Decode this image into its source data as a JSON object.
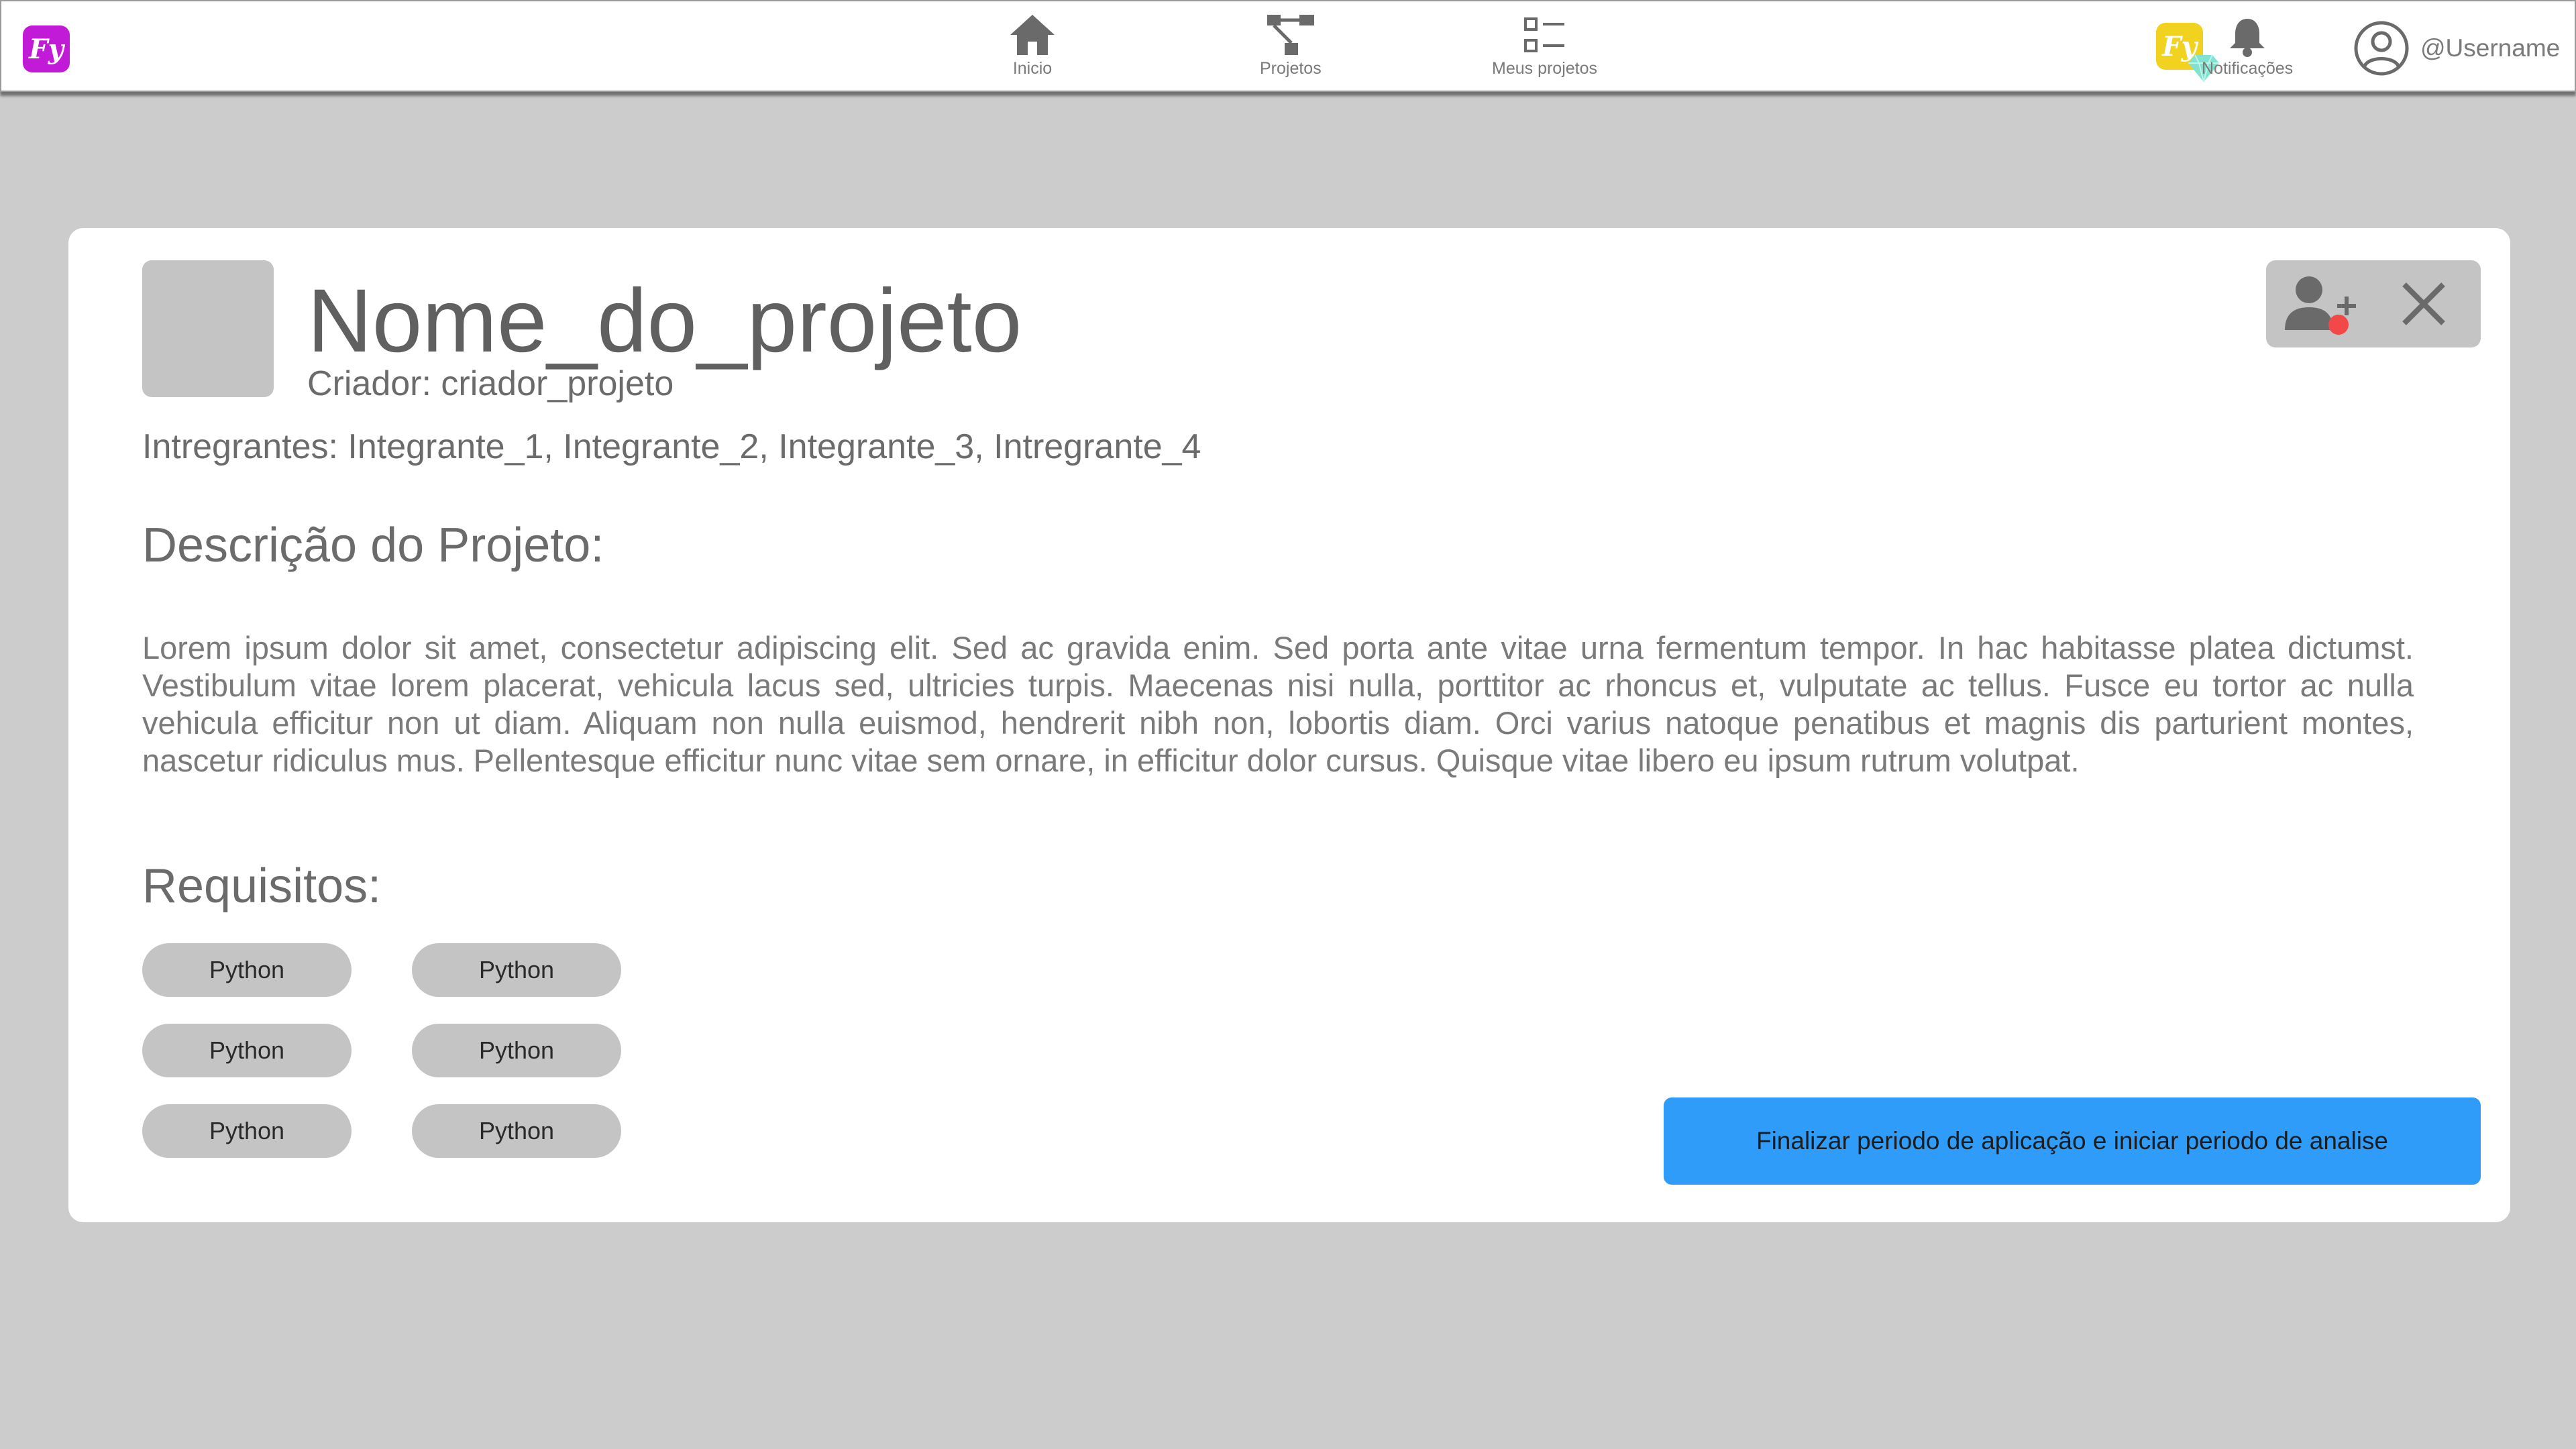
{
  "header": {
    "logo_text": "Fy",
    "nav": [
      {
        "label": "Inicio",
        "icon": "home-icon"
      },
      {
        "label": "Projetos",
        "icon": "project-tree-icon"
      },
      {
        "label": "Meus projetos",
        "icon": "list-icon"
      }
    ],
    "badge_text": "Fy",
    "notifications_label": "Notificações",
    "username": "@Username"
  },
  "project": {
    "name": "Nome_do_projeto",
    "creator": "Criador: criador_projeto",
    "members": "Intregrantes: Integrante_1, Integrante_2, Integrante_3, Intregrante_4",
    "description_title": "Descrição do Projeto:",
    "description": "Lorem ipsum dolor sit amet, consectetur adipiscing elit. Sed ac gravida enim. Sed porta ante vitae urna fermentum tempor. In hac habitasse platea dictumst. Vestibulum vitae lorem placerat, vehicula lacus sed, ultricies turpis. Maecenas nisi nulla, porttitor ac rhoncus et, vulputate ac tellus. Fusce eu tortor ac nulla vehicula efficitur non ut diam. Aliquam non nulla euismod, hendrerit nibh non, lobortis diam. Orci varius natoque penatibus et magnis dis parturient montes, nascetur ridiculus mus. Pellentesque efficitur nunc vitae sem ornare, in efficitur dolor cursus. Quisque vitae libero eu ipsum rutrum volutpat.",
    "requirements_title": "Requisitos:",
    "requirements": [
      "Python",
      "Python",
      "Python",
      "Python",
      "Python",
      "Python"
    ]
  },
  "actions": {
    "finalize_label": "Finalizar periodo de aplicação e iniciar periodo de analise"
  },
  "colors": {
    "background": "#cccccc",
    "logo": "#c21bd8",
    "badge": "#f1d21e",
    "cta": "#2e9cf8",
    "notification_dot": "#f24848"
  }
}
